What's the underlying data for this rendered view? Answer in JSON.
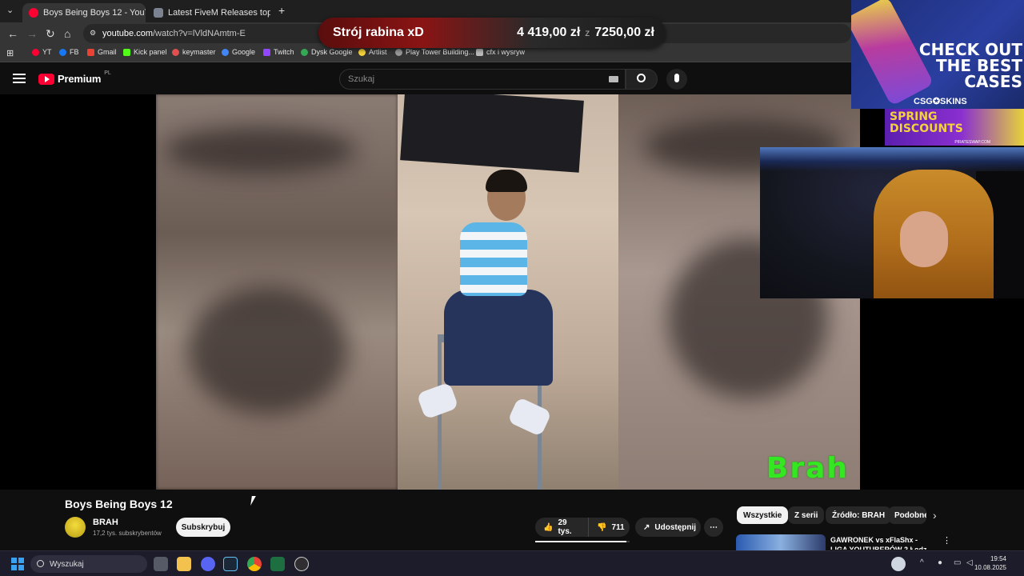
{
  "browser": {
    "tabs": [
      {
        "title": "Boys Being Boys 12 - YouTu",
        "active": true
      },
      {
        "title": "Latest FiveM Releases topics - C",
        "active": false
      }
    ],
    "url": {
      "host": "youtube.com",
      "path": "/watch?v=lVldNAmtm-E"
    },
    "bookmarks": [
      "YT",
      "FB",
      "Gmail",
      "Kick panel",
      "keymaster",
      "Google",
      "Twitch",
      "Dysk Google",
      "Artlist",
      "Play Tower Building...",
      "cfx i wysryw"
    ]
  },
  "donation": {
    "title": "Strój rabina xD",
    "current": "4 419,00 zł",
    "separator": "z",
    "goal": "7250,00 zł"
  },
  "youtube": {
    "logo_text": "Premium",
    "region": "PL",
    "search_placeholder": "Szukaj",
    "video_overlay_text": "Brah",
    "video": {
      "title": "Boys Being Boys 12",
      "channel": "BRAH",
      "subscribers": "17,2 tys. subskrybentów",
      "subscribe_label": "Subskrybuj",
      "likes": "29 tys.",
      "dislikes": "711",
      "share_label": "Udostępnij",
      "like_ratio": 0.97
    },
    "chips": [
      "Wszystkie",
      "Z serii",
      "Źródło: BRAH",
      "Podobne"
    ],
    "recommended": [
      {
        "title": "GAWRONEK vs xFlaShx - LIGA YOUTUBERÓW 2 Łodz, Z..."
      }
    ]
  },
  "stream_overlays": {
    "ad_headline": "CHECK OUT THE BEST CASES",
    "ad_brand": "CSG✪SKINS",
    "spring_ad": "SPRING DISCOUNTS",
    "spring_ad_sub": "PIRATESWAP.COM"
  },
  "taskbar": {
    "search_placeholder": "Wyszukaj",
    "time": "19:54",
    "date": "10.08.2025"
  },
  "colors": {
    "youtube_red": "#ff0033",
    "overlay_green": "#34e821",
    "win_blue": "#3aa0f0"
  }
}
